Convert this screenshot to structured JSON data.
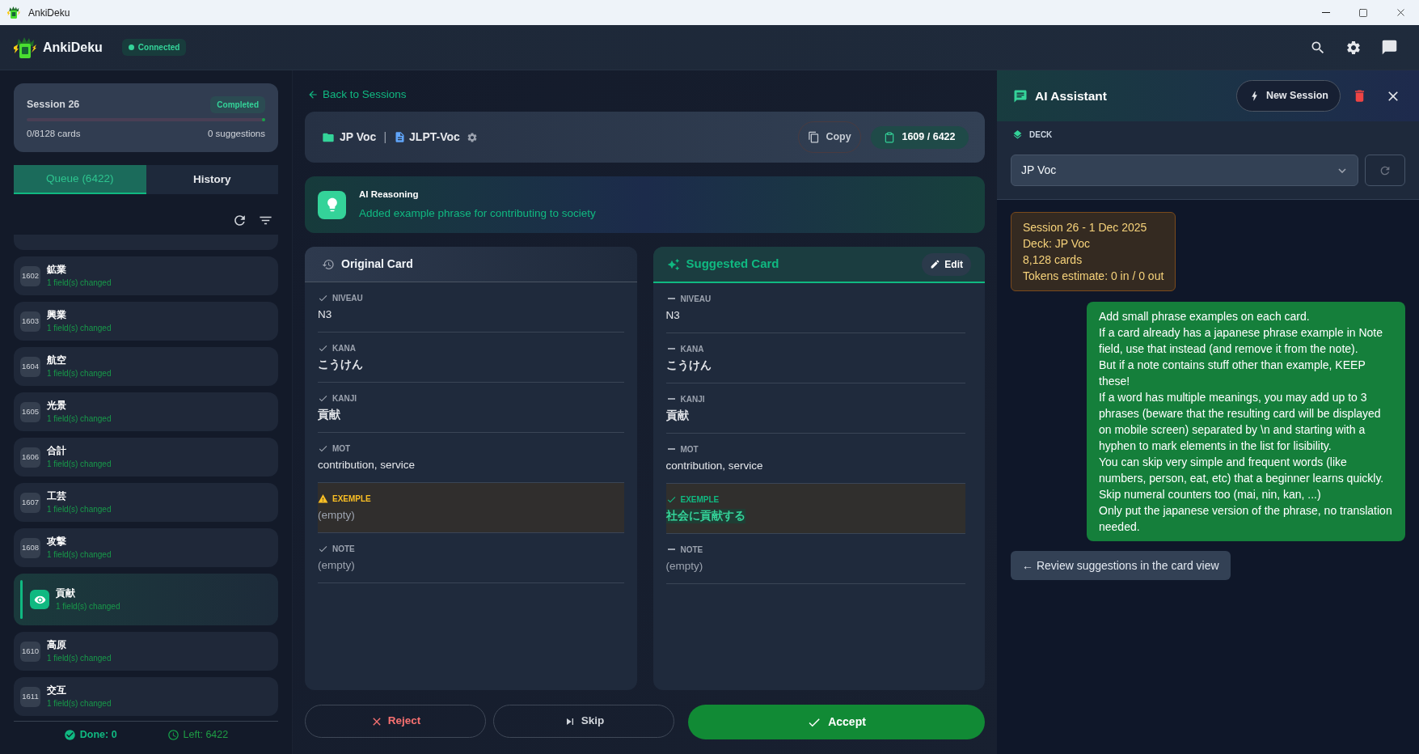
{
  "window": {
    "title": "AnkiDeku"
  },
  "header": {
    "app_name": "AnkiDeku",
    "status": "Connected",
    "connected": true
  },
  "sidebar": {
    "session": {
      "title": "Session 26",
      "status": "Completed",
      "level": 1,
      "cards": "0/8128 cards",
      "suggestions": "0 suggestions"
    },
    "tabs": [
      {
        "label": "Queue (6422)",
        "selected": true
      },
      {
        "label": "History",
        "selected": false
      }
    ],
    "queue": [
      {
        "number": "1602",
        "word": "鉱業",
        "changes": "1 field(s) changed",
        "selected": false
      },
      {
        "number": "1603",
        "word": "興業",
        "changes": "1 field(s) changed",
        "selected": false
      },
      {
        "number": "1604",
        "word": "航空",
        "changes": "1 field(s) changed",
        "selected": false
      },
      {
        "number": "1605",
        "word": "光景",
        "changes": "1 field(s) changed",
        "selected": false
      },
      {
        "number": "1606",
        "word": "合計",
        "changes": "1 field(s) changed",
        "selected": false
      },
      {
        "number": "1607",
        "word": "工芸",
        "changes": "1 field(s) changed",
        "selected": false
      },
      {
        "number": "1608",
        "word": "攻撃",
        "changes": "1 field(s) changed",
        "selected": false
      },
      {
        "word": "貢献",
        "changes": "1 field(s) changed",
        "selected": true
      },
      {
        "number": "1610",
        "word": "高原",
        "changes": "1 field(s) changed",
        "selected": false
      },
      {
        "number": "1611",
        "word": "交互",
        "changes": "1 field(s) changed",
        "selected": false
      }
    ],
    "footer": {
      "done": "Done: 0",
      "left": "Left: 6422"
    }
  },
  "main": {
    "back_link": "Back to Sessions",
    "deck_bar": {
      "deck": "JP Voc",
      "separator": "|",
      "note_type": "JLPT-Voc",
      "copy_button": "Copy",
      "position": "1609 / 6422"
    },
    "reasoning": {
      "title": "AI Reasoning",
      "text": "Added example phrase for contributing to society"
    },
    "original_card": {
      "title": "Original Card",
      "fields": [
        {
          "label": "NIVEAU",
          "value": "N3",
          "kind": "ok",
          "bold": false,
          "empty": false
        },
        {
          "label": "KANA",
          "value": "こうけん",
          "kind": "ok",
          "bold": true,
          "empty": false
        },
        {
          "label": "KANJI",
          "value": "貢献",
          "kind": "ok",
          "bold": true,
          "empty": false
        },
        {
          "label": "MOT",
          "value": "contribution, service",
          "kind": "ok",
          "bold": false,
          "empty": false
        },
        {
          "label": "EXEMPLE",
          "value": "(empty)",
          "kind": "missing",
          "bold": false,
          "empty": true
        },
        {
          "label": "NOTE",
          "value": "(empty)",
          "kind": "ok",
          "bold": false,
          "empty": true
        }
      ]
    },
    "suggested_card": {
      "title": "Suggested Card",
      "edit_button": "Edit",
      "fields": [
        {
          "label": "NIVEAU",
          "value": "N3",
          "kind": "same",
          "bold": false,
          "empty": false
        },
        {
          "label": "KANA",
          "value": "こうけん",
          "kind": "same",
          "bold": true,
          "empty": false
        },
        {
          "label": "KANJI",
          "value": "貢献",
          "kind": "same",
          "bold": true,
          "empty": false
        },
        {
          "label": "MOT",
          "value": "contribution, service",
          "kind": "same",
          "bold": false,
          "empty": false
        },
        {
          "label": "EXEMPLE",
          "value": "社会に貢献する",
          "kind": "changed",
          "bold": true,
          "empty": false
        },
        {
          "label": "NOTE",
          "value": "(empty)",
          "kind": "same",
          "bold": false,
          "empty": true
        }
      ]
    },
    "actions": {
      "reject": "Reject",
      "skip": "Skip",
      "accept": "Accept"
    }
  },
  "assistant": {
    "title": "AI Assistant",
    "new_session_button": "New Session",
    "deck_label": "DECK",
    "deck_select": "JP Voc",
    "messages": [
      {
        "kind": "info",
        "lines": [
          "Session 26 - 1 Dec 2025",
          "Deck: JP Voc",
          "8,128 cards",
          "Tokens estimate: 0 in / 0 out"
        ]
      },
      {
        "kind": "user",
        "paragraphs": [
          "Add small phrase examples on each card.",
          "If a card already has a japanese phrase example in Note field, use that instead (and remove it from the note).",
          "But if a note contains stuff other than example, KEEP these!",
          "If a word has multiple meanings, you may add up to 3 phrases (beware that the resulting card will be displayed on mobile screen) separated by \\n and starting with a hyphen to mark elements in the list for lisibility.",
          "You can skip very simple and frequent words (like numbers, person, eat, etc) that a beginner learns quickly. Skip numeral counters too (mai, nin, kan, ...)",
          "Only put the japanese version of the phrase, no translation needed."
        ]
      }
    ],
    "review_button": "← Review suggestions in the card view"
  }
}
